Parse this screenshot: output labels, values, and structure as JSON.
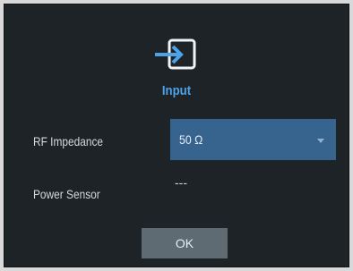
{
  "dialog": {
    "title": "Input",
    "icon": "input-arrow-icon",
    "accent_color": "#4da3e8",
    "background_color": "#1e2327"
  },
  "rf_impedance": {
    "label": "RF Impedance",
    "value": "50 Ω",
    "field_color": "#37638f"
  },
  "power_sensor": {
    "label": "Power Sensor",
    "value": "---"
  },
  "buttons": {
    "ok_label": "OK"
  }
}
